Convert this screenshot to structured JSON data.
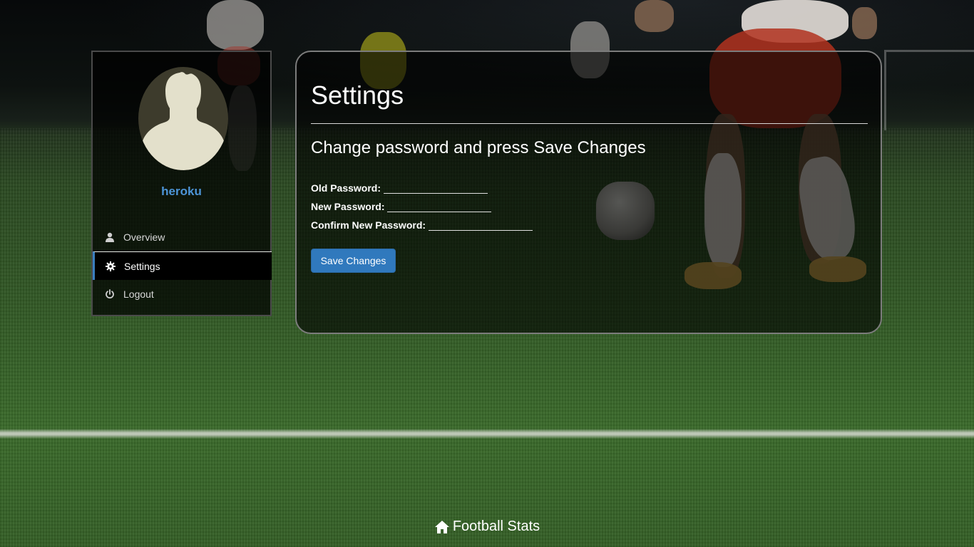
{
  "user": {
    "username": "heroku"
  },
  "sidebar": {
    "items": [
      {
        "label": "Overview",
        "icon": "person-icon",
        "active": false
      },
      {
        "label": "Settings",
        "icon": "gear-icon",
        "active": true
      },
      {
        "label": "Logout",
        "icon": "power-icon",
        "active": false
      }
    ]
  },
  "main": {
    "title": "Settings",
    "subtitle": "Change password and press Save Changes",
    "fields": {
      "old_password": {
        "label": "Old Password:",
        "value": ""
      },
      "new_password": {
        "label": "New Password:",
        "value": ""
      },
      "confirm_password": {
        "label": "Confirm New Password:",
        "value": ""
      }
    },
    "save_label": "Save Changes"
  },
  "footer": {
    "brand": "Football Stats",
    "icon": "home-icon"
  },
  "colors": {
    "accent": "#3079bd",
    "username": "#4d95d8",
    "active_border": "#3a7fc0"
  }
}
